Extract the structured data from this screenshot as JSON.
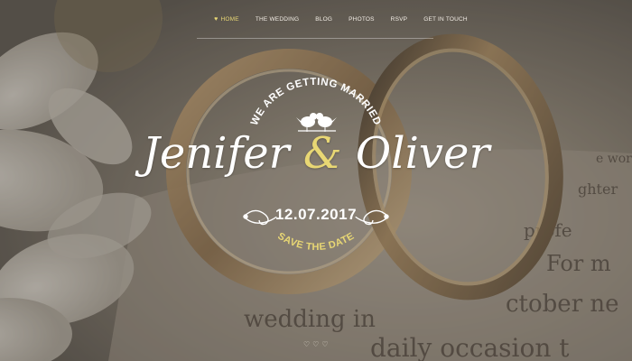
{
  "nav": {
    "items": [
      {
        "label": "HOME",
        "active": true
      },
      {
        "label": "THE WEDDING",
        "active": false
      },
      {
        "label": "BLOG",
        "active": false
      },
      {
        "label": "PHOTOS",
        "active": false
      },
      {
        "label": "RSVP",
        "active": false
      },
      {
        "label": "GET IN TOUCH",
        "active": false
      }
    ],
    "active_icon": "heart-icon"
  },
  "hero": {
    "tagline": "WE ARE GETTING MARRIED",
    "name_one": "Jenifer",
    "ampersand": "&",
    "name_two": "Oliver",
    "date": "12.07.2017",
    "save_the_date": "SAVE THE DATE",
    "birds_icon": "love-birds-icon",
    "ornament_icon": "scroll-ornament-icon"
  },
  "slider": {
    "dots": [
      "♡",
      "♡",
      "♡"
    ],
    "dot_icon": "heart-outline-icon"
  },
  "background": {
    "text_lines": [
      "profe",
      "For m",
      "ctober ne",
      "wedding in",
      "daily occasion t",
      "ghter",
      "e wor"
    ],
    "description_icon": "wedding-rings-photo"
  },
  "colors": {
    "accent": "#e8d774",
    "text": "#ffffff"
  }
}
